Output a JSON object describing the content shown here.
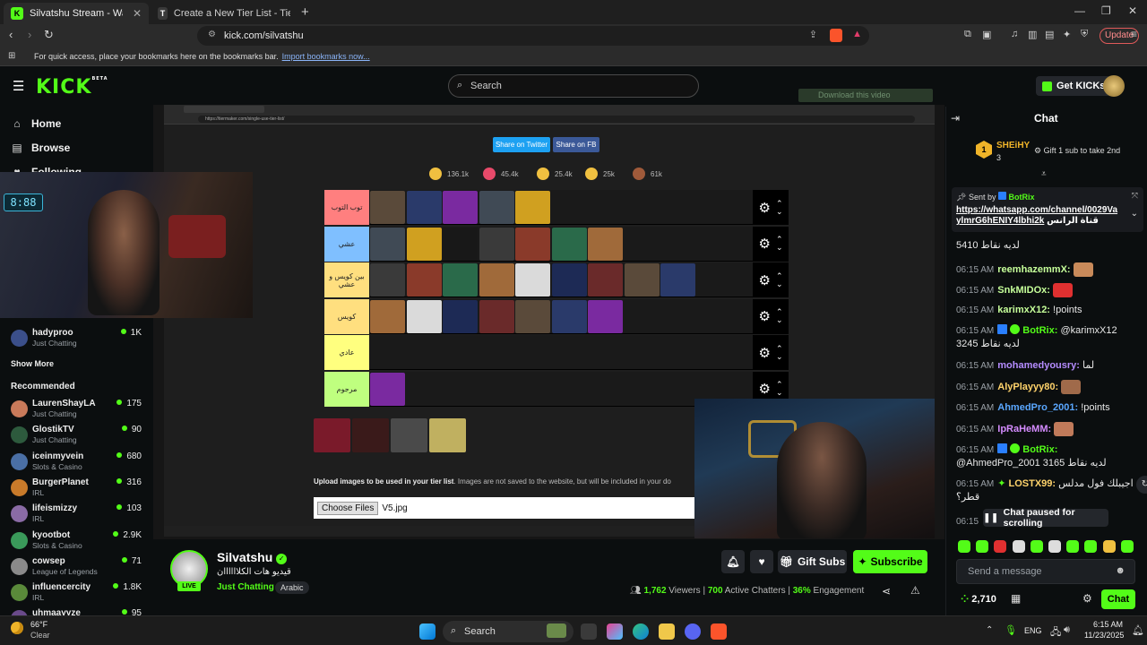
{
  "browser": {
    "tabs": [
      {
        "title": "Silvatshu Stream - Watch Live",
        "icon": "K",
        "active": true
      },
      {
        "title": "Create a New Tier List - TierMaker",
        "icon": "T",
        "active": false
      }
    ],
    "url": "kick.com/silvatshu",
    "update_label": "Update",
    "bookmark_hint": "For quick access, place your bookmarks here on the bookmarks bar.",
    "bookmark_link": "Import bookmarks now..."
  },
  "kick": {
    "logo": "KICK",
    "logo_beta": "BETA",
    "search_placeholder": "Search",
    "get_kicks": "Get KICKs",
    "download_video": "Download this video"
  },
  "sidebar": {
    "nav": [
      {
        "label": "Home",
        "icon": "home-icon"
      },
      {
        "label": "Browse",
        "icon": "browse-icon"
      },
      {
        "label": "Following",
        "icon": "heart-icon"
      }
    ],
    "following_channels": [
      {
        "name": "hadyproo",
        "category": "Just Chatting",
        "viewers": "1K"
      }
    ],
    "show_more": "Show More",
    "recommended_title": "Recommended",
    "recommended": [
      {
        "name": "LaurenShayLA",
        "category": "Just Chatting",
        "viewers": "175"
      },
      {
        "name": "GlostikTV",
        "category": "Just Chatting",
        "viewers": "90"
      },
      {
        "name": "iceinmyvein",
        "category": "Slots & Casino",
        "viewers": "680"
      },
      {
        "name": "BurgerPlanet",
        "category": "IRL",
        "viewers": "316"
      },
      {
        "name": "lifeismizzy",
        "category": "IRL",
        "viewers": "103"
      },
      {
        "name": "kyootbot",
        "category": "Slots & Casino",
        "viewers": "2.9K"
      },
      {
        "name": "cowsep",
        "category": "League of Legends",
        "viewers": "71"
      },
      {
        "name": "influencercity",
        "category": "IRL",
        "viewers": "1.8K"
      },
      {
        "name": "uhmaayyze",
        "category": "",
        "viewers": "95"
      }
    ]
  },
  "tiermaker": {
    "inner_url": "https://tiermaker.com/single-use-tier-list/",
    "share_twitter": "Share on Twitter",
    "share_fb": "Share on FB",
    "reactions": [
      "136.1k",
      "45.4k",
      "25.4k",
      "25k",
      "61k"
    ],
    "tiers": [
      {
        "label": "توب التوب",
        "color": "#ff7f7f",
        "tiles": 5
      },
      {
        "label": "عشي",
        "color": "#7fbfff",
        "tiles": 7
      },
      {
        "label": "بين كويس و عشي",
        "color": "#ffdf7f",
        "tiles": 9
      },
      {
        "label": "كويس",
        "color": "#ffdf7f",
        "tiles": 7
      },
      {
        "label": "عادي",
        "color": "#ffff7f",
        "tiles": 0
      },
      {
        "label": "مرجوم",
        "color": "#bfff7f",
        "tiles": 1
      }
    ],
    "pool_tiles": 4,
    "upload_heading": "Upload images to be used in your tier list",
    "upload_note": ". Images are not saved to the website, but will be included in your do",
    "choose_files": "Choose Files",
    "file_name": "V5.jpg"
  },
  "stream": {
    "streamer": "Silvatshu",
    "title": "قيديو هات الكلاااااان",
    "category": "Just Chatting",
    "language": "Arabic",
    "live_badge": "LIVE",
    "gift_subs": "Gift Subs",
    "subscribe": "Subscribe",
    "viewers": "1,762",
    "viewers_label": "Viewers",
    "chatters": "700",
    "chatters_label": "Active Chatters",
    "engagement": "36%",
    "engagement_label": "Engagement"
  },
  "chat": {
    "title": "Chat",
    "gifter": {
      "name": "SHEiHY",
      "count": "3",
      "cta": "Gift 1 sub to take 2nd"
    },
    "pinned": {
      "sent_by": "Sent by",
      "bot": "BotRix",
      "link": "https://whatsapp.com/channel/0029Va",
      "link2": "ylmrG6hENIY4lbhi2k",
      "link_suffix": "قناة الرانس"
    },
    "messages": [
      {
        "time": "",
        "user": "",
        "color": "#e8e8e8",
        "text": "5410 لديه نقاط"
      },
      {
        "time": "06:15 AM",
        "user": "reemhazemmX:",
        "color": "#c6ff9a",
        "text": ""
      },
      {
        "time": "06:15 AM",
        "user": "SnkMIDOx:",
        "color": "#c6ff9a",
        "text": ""
      },
      {
        "time": "06:15 AM",
        "user": "karimxX12:",
        "color": "#c6ff9a",
        "text": "!points"
      },
      {
        "time": "06:15 AM",
        "user": "BotRix:",
        "color": "#53fc18",
        "text": "@karimxX12 3245 لديه نقاط"
      },
      {
        "time": "06:15 AM",
        "user": "mohamedyousry:",
        "color": "#b58cff",
        "text": "لما"
      },
      {
        "time": "06:15 AM",
        "user": "AlyPlayyy80:",
        "color": "#ffd36b",
        "text": ""
      },
      {
        "time": "06:15 AM",
        "user": "AhmedPro_2001:",
        "color": "#5aa7ff",
        "text": "!points"
      },
      {
        "time": "06:15 AM",
        "user": "IpRaHeMM:",
        "color": "#d58cff",
        "text": ""
      },
      {
        "time": "06:15 AM",
        "user": "BotRix:",
        "color": "#53fc18",
        "text": "@AhmedPro_2001 3165 لديه نقاط"
      },
      {
        "time": "06:15 AM",
        "user": "LOSTX99:",
        "color": "#ffd36b",
        "text": "اجيبلك فول مدلس قطر؟"
      },
      {
        "time": "06:15",
        "user": "",
        "color": "#e8e8e8",
        "text": ""
      }
    ],
    "paused": "Chat paused for scrolling",
    "send_placeholder": "Send a message",
    "points": "2,710",
    "chat_button": "Chat"
  },
  "taskbar": {
    "weather_temp": "66°F",
    "weather_desc": "Clear",
    "search": "Search",
    "lang": "ENG",
    "time": "6:15 AM",
    "date": "11/23/2025"
  }
}
